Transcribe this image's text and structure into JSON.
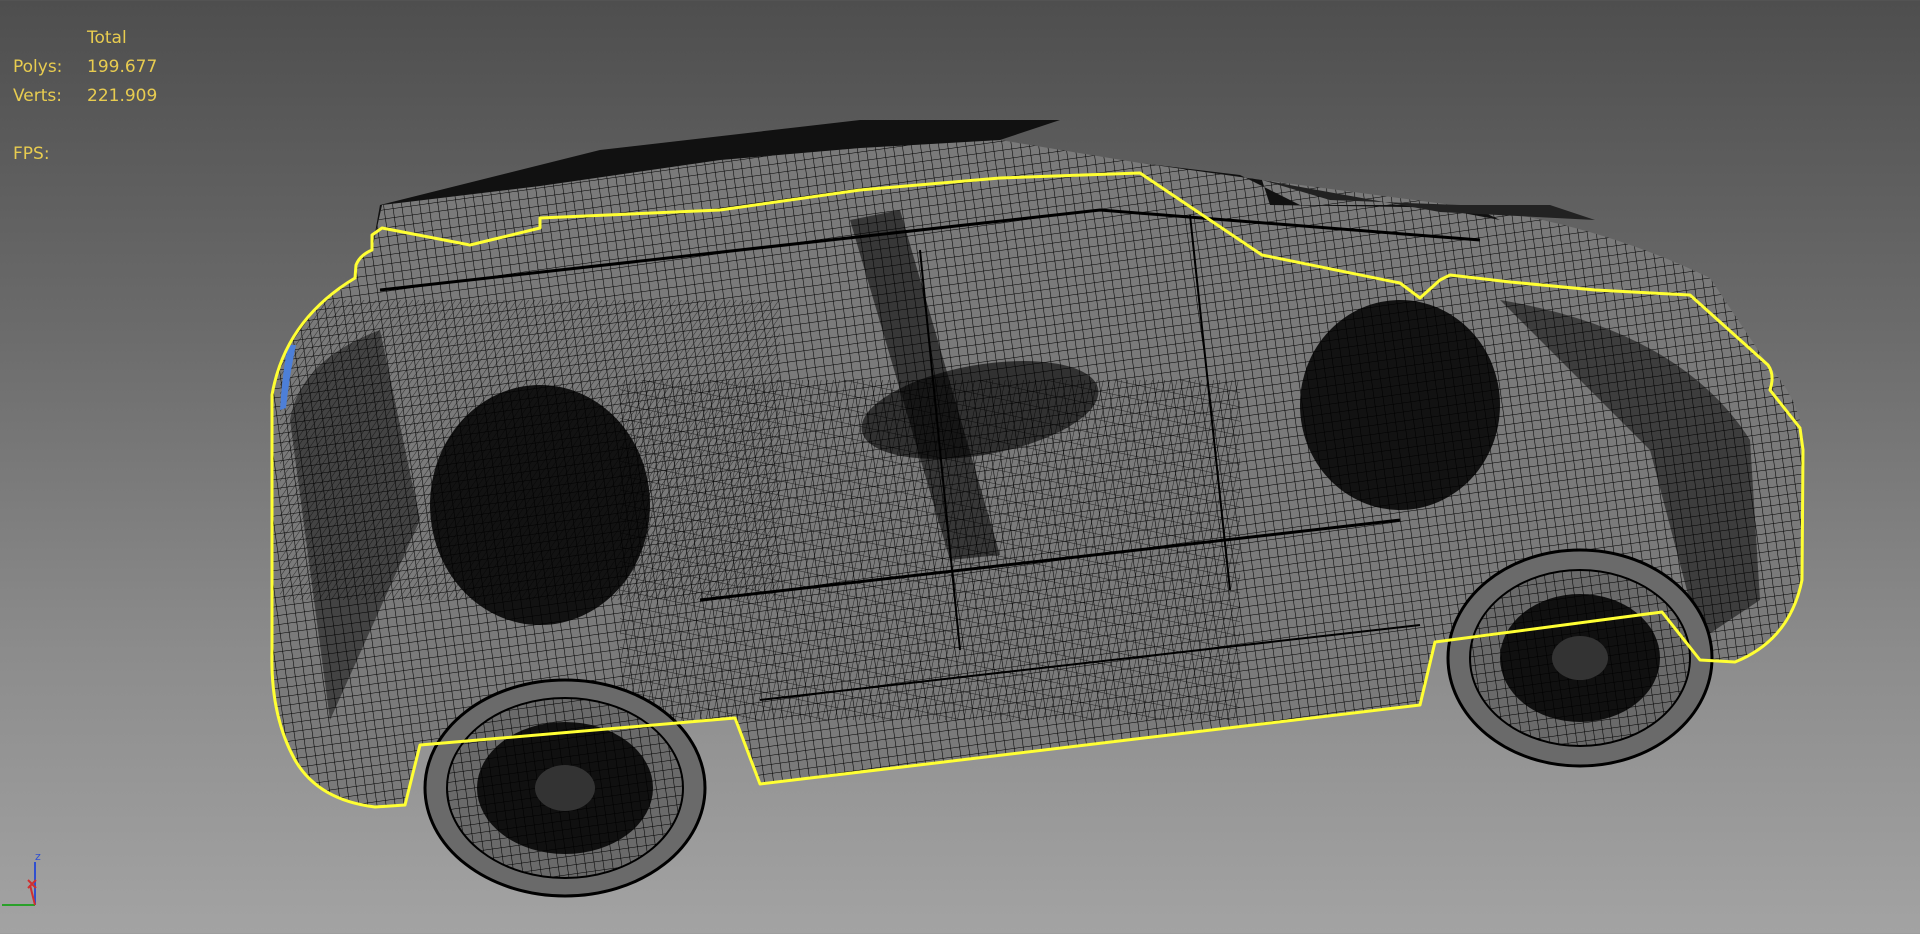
{
  "viewport": {
    "background_top": "#4e4e4e",
    "background_bottom": "#a3a3a3",
    "selection_outline_color": "#ffff33",
    "wire_color": "#000000"
  },
  "stats": {
    "header": "Total",
    "polys_label": "Polys:",
    "polys_value": "199.677",
    "verts_label": "Verts:",
    "verts_value": "221.909",
    "fps_label": "FPS:",
    "fps_value": ""
  },
  "gizmo": {
    "z_label": "z",
    "x_color": "#d03030",
    "y_color": "#2aa02a",
    "z_color": "#3050d0"
  }
}
